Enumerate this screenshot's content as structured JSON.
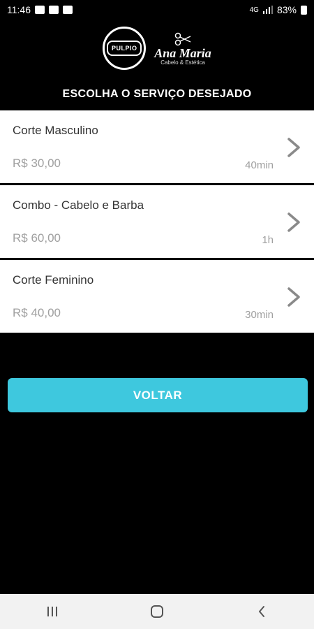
{
  "status_bar": {
    "time": "11:46",
    "network": "4G",
    "battery": "83%"
  },
  "brand": {
    "badge_text": "PULPIO",
    "name": "Ana Maria",
    "tagline": "Cabelo & Estética"
  },
  "page": {
    "title": "ESCOLHA O SERVIÇO DESEJADO"
  },
  "services": [
    {
      "name": "Corte Masculino",
      "price": "R$ 30,00",
      "duration": "40min"
    },
    {
      "name": "Combo - Cabelo e Barba",
      "price": "R$ 60,00",
      "duration": "1h"
    },
    {
      "name": "Corte Feminino",
      "price": "R$ 40,00",
      "duration": "30min"
    }
  ],
  "actions": {
    "back_label": "VOLTAR"
  },
  "colors": {
    "accent": "#3ec8de",
    "background": "#000000",
    "card": "#ffffff"
  },
  "icons": {
    "nav": [
      "recent-apps-icon",
      "home-icon",
      "back-icon"
    ],
    "card_arrow": "chevron-right-icon"
  }
}
